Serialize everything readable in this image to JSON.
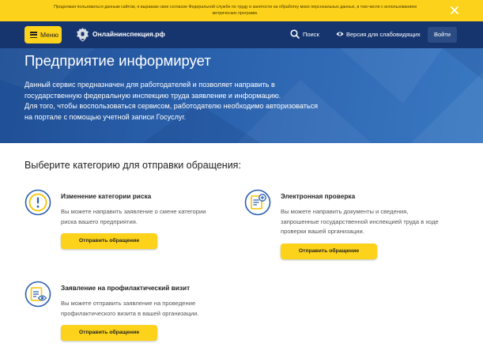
{
  "cookie_banner": {
    "lines": [
      "Продолжая пользоваться данным сайтом, я выражаю свое согласие Федеральной службе по труду и занятости на обработку моих персональных данных, в том числе с использованием",
      "метрических программ."
    ]
  },
  "header": {
    "menu_label": "Меню",
    "logo_text": "Онлайнинспекция.рф",
    "search_label": "Поиск",
    "vision_label": "Версия для слабовидящих",
    "login_label": "Войти"
  },
  "hero": {
    "title": "Предприятие информирует",
    "lines": [
      "Данный сервис предназначен для работодателей и позволяет направить в",
      "государственную федеральную инспекцию труда заявление и информацию.",
      "Для того, чтобы воспользоваться сервисом, работодателю необходимо авторизоваться",
      "на портале с помощью учетной записи Госуслуг."
    ]
  },
  "categories": {
    "title": "Выберите категорию для отправки обращения:",
    "items": [
      {
        "title": "Изменение категории риска",
        "desc": [
          "Вы можете направить заявление о смене категории",
          "риска вашего предприятия."
        ],
        "button": "Отправить обращение",
        "icon": "alert-circle-icon"
      },
      {
        "title": "Электронная проверка",
        "desc": [
          "Вы можете направить документы и сведения,",
          "запрошенные государственной инспекцией труда в ходе",
          "проверки вашей организации."
        ],
        "button": "Отправить обращение",
        "icon": "document-add-icon"
      },
      {
        "title": "Заявление на профилактический визит",
        "desc": [
          "Вы можете отправить заявление на проведение",
          "профилактического визита в вашей организации."
        ],
        "button": "Отправить обращение",
        "icon": "document-view-icon"
      }
    ]
  },
  "colors": {
    "accent": "#fcd21a",
    "header_bg": "#16356f",
    "hero_bg": "#2b62ae",
    "icon_blue": "#2a5fb0",
    "icon_yellow": "#f5c400"
  }
}
